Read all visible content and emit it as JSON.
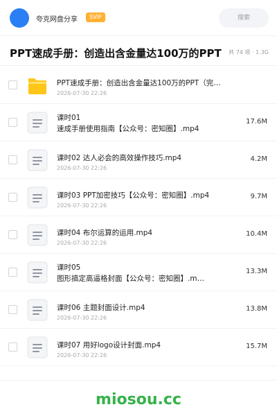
{
  "topbar": {
    "username": "夸克网盘分享",
    "badge": "SVIP",
    "search_placeholder": "搜索"
  },
  "header": {
    "title": "PPT速成手册：创造出含金量达100万的PPT",
    "meta": "共 74 项 · 1.3G"
  },
  "files": [
    {
      "type": "folder-icon",
      "name": [
        "PPT速成手册：创造出含金量达100万的PPT（完…"
      ],
      "date": "2026-07-30 22:26",
      "size": ""
    },
    {
      "type": "file-icon",
      "name": [
        "课时01",
        "速成手册使用指南【公众号：密知圈】.mp4"
      ],
      "date": "2026-07-30 22:26",
      "size": "17.6M"
    },
    {
      "type": "file-icon",
      "name": [
        "课时02 达人必会的高效操作技巧.mp4"
      ],
      "date": "2026-07-30 22:26",
      "size": "4.2M"
    },
    {
      "type": "file-icon",
      "name": [
        "课时03 PPT加密技巧【公众号：密知圈】.mp4"
      ],
      "date": "2026-07-30 22:26",
      "size": "9.7M"
    },
    {
      "type": "file-icon",
      "name": [
        "课时04 布尔运算的运用.mp4"
      ],
      "date": "2026-07-30 22:26",
      "size": "10.4M"
    },
    {
      "type": "file-icon",
      "name": [
        "课时05",
        "图形搞定高逼格封面【公众号：密知圈】.m…"
      ],
      "date": "2026-07-30 22:26",
      "size": "13.3M"
    },
    {
      "type": "file-icon",
      "name": [
        "课时06 主题封面设计.mp4"
      ],
      "date": "2026-07-30 22:26",
      "size": "13.8M"
    },
    {
      "type": "file-icon",
      "name": [
        "课时07 用好logo设计封面.mp4"
      ],
      "date": "2026-07-30 22:26",
      "size": "15.7M"
    }
  ],
  "watermark": "miosou.cc",
  "colors": {
    "accent": "#2b7ff5",
    "badge": "#ffb033",
    "watermark": "#36b24a",
    "folder": "#ffc61a"
  }
}
